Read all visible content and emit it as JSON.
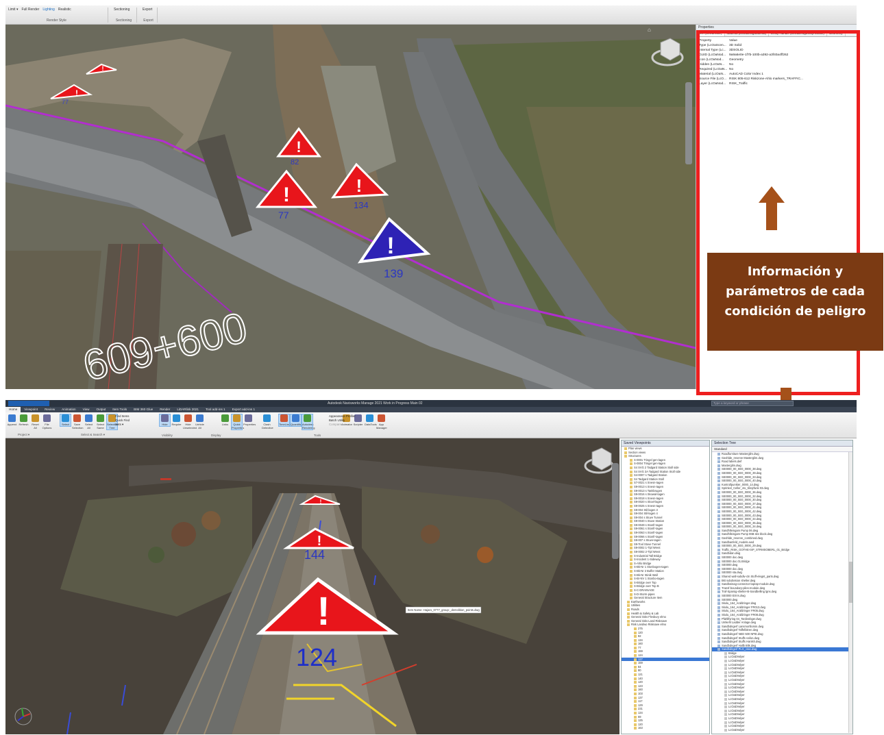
{
  "top_ribbon": {
    "groups": [
      {
        "title": "Render Style",
        "items": [
          "Limit ▾",
          "Full Render",
          "Lighting",
          "Realistic"
        ]
      },
      {
        "title": "Sectioning",
        "items": [
          "Sectioning"
        ]
      },
      {
        "title": "Export",
        "items": [
          "Export"
        ]
      }
    ]
  },
  "properties_panel": {
    "title": "Properties",
    "tabs": [
      "Item (LcOaNode)",
      "Material (LcOaDrwgMaterial)",
      "Entity Handle (LcOaDrwgEntityHandle)",
      "Geometry"
    ],
    "header": {
      "key": "Property",
      "value": "Value"
    },
    "rows": [
      {
        "k": "Type (LcOaScen...",
        "v": "3D Solid"
      },
      {
        "k": "Internal Type (Lc...",
        "v": "3DSOLID"
      },
      {
        "k": "GUID (LcOaNod...",
        "v": "9a9a6e0e-1f7b-100b-a392-a3f40a4ff262"
      },
      {
        "k": "Icon (LcOaNod...",
        "v": "Geometry"
      },
      {
        "k": "Hidden (LcOaN...",
        "v": "No"
      },
      {
        "k": "Required (LcOaN...",
        "v": "No"
      },
      {
        "k": "Material (LcOaN...",
        "v": "AutoCAD Color Index 1"
      },
      {
        "k": "Source File (LcO...",
        "v": "RISK 805-612 Riskzone-Ahlo markers_TRAFFIC..."
      },
      {
        "k": "Layer (LcOaNod...",
        "v": "RISK_Traffic"
      }
    ]
  },
  "callout": {
    "line1": "Información y",
    "line2": "parámetros de cada",
    "line3": "condición de peligro"
  },
  "viewport_top": {
    "chainage": "609+600",
    "hazards": [
      "77",
      "82",
      "77",
      "134",
      "139"
    ]
  },
  "app": {
    "title": "Autodesk Navisworks Manage 2021   Work in Progress Main 02",
    "search_placeholder": "Type a keyword or phrase",
    "tabs": [
      "Home",
      "Viewpoint",
      "Review",
      "Animation",
      "View",
      "Output",
      "Item Tools",
      "BIM 360 Glue",
      "Render",
      "LiDARlink 2021",
      "Tool add-ins 1",
      "Export add-ins 1"
    ],
    "tools": [
      {
        "label": "Append",
        "sel": false
      },
      {
        "label": "Refresh",
        "sel": false
      },
      {
        "label": "Reset All",
        "sel": false
      },
      {
        "label": "File Options",
        "sel": false
      },
      {
        "label": "Select",
        "sel": true
      },
      {
        "label": "Save Selection",
        "sel": false
      },
      {
        "label": "Select All",
        "sel": false
      },
      {
        "label": "Select Same",
        "sel": false
      },
      {
        "label": "Selection Tree",
        "sel": true
      },
      {
        "label": "Hide",
        "sel": true
      },
      {
        "label": "Require",
        "sel": false
      },
      {
        "label": "Hide Unselected",
        "sel": false
      },
      {
        "label": "Unhide All",
        "sel": false
      },
      {
        "label": "Links",
        "sel": false
      },
      {
        "label": "Quick Properties",
        "sel": true
      },
      {
        "label": "Properties",
        "sel": false
      },
      {
        "label": "Clash Detective",
        "sel": false
      },
      {
        "label": "TimeLiner",
        "sel": true
      },
      {
        "label": "Quantification",
        "sel": true
      },
      {
        "label": "Autodesk Rendering",
        "sel": true
      },
      {
        "label": "Animator",
        "sel": false
      },
      {
        "label": "Scripter",
        "sel": false
      },
      {
        "label": "DataTools",
        "sel": false
      },
      {
        "label": "App Manager",
        "sel": false
      }
    ],
    "find_items": [
      "Find Items",
      "Quick Find",
      "Sets ▾"
    ],
    "tools_menu": [
      "Appearance Profiler",
      "Batch Utility",
      "Compare"
    ],
    "groups": [
      "Project ▾",
      "Select & Search ▾",
      "Visibility",
      "Display",
      "Tools"
    ]
  },
  "viewport_bottom": {
    "hazards": [
      "",
      "144",
      "124"
    ],
    "tooltip": "Item Name: Hajaro_0777_group:_demolition_points.dwg"
  },
  "selection_tree": {
    "title": "Saved Viewpoints",
    "rows": [
      "Plan views",
      "Section views",
      "Structures",
      "S-0001 Tringel gen-lagen",
      "S-0004 Tringel gen-lagen",
      "S4 SVG 2 Tadgard Station Stoll side",
      "S4 SVG 3A Tadgard Station Stoll side",
      "S4-0007 s Tadgard Station",
      "S4 Tadgard Station Stoll",
      "S7-0021 s Snesn-tagen",
      "S9-0013 s Snesn-tagen",
      "S9-0013 s Tankbrugen",
      "S9-0016 s Skowal-tagen",
      "S9-0018 s Snesn-tagen",
      "S9-0020 s Skovl-lagen",
      "S9-0025 s Snesn-tagen",
      "S9-004 Stil-lagen 3",
      "S9-004 Stil-lagen 4",
      "S9-004 s Stuve Tunnel",
      "S9-0040 s Stuve Station",
      "S9-0049 s Stonfr-tagen",
      "S9-0061 s Stonfr-tagen",
      "S9-0063 s Stonfr-tagen",
      "S9-0066 s Stonfr-tagen",
      "S9-007 s Stuve-tagen",
      "S9-Tool Stove Tunnel",
      "S9-0002 1-Tipl Wrest",
      "S9-0002 2-Tipl Wrest",
      "S-Industrial Tall Bridge",
      "S-Incident 1-Sideway",
      "S-Ahlo Bridge",
      "S-Bk-Nr 1 Stonbogen-tagen",
      "S-Bk-Nr 2 Buffer Station",
      "S-Bk-Nr Stinik Wall",
      "S-Br-NV 1 Stonbo-tagen",
      "S-Bridge over Top",
      "S-Bridge over Top B",
      "S-C-DRAINAGE",
      "S-D-Storm-pipes",
      "General Structure Item",
      "Earthworks",
      "Utilities",
      "Roads",
      "Health & Safety & Lab",
      "General risks Flesbury elmo",
      "General risks Land Risksave",
      "Risk Landwo Risksave elmo",
      "275",
      "120",
      "82",
      "134",
      "160",
      "77",
      "159",
      "124",
      "127",
      "159",
      "84",
      "80",
      "121",
      "140",
      "120",
      "123",
      "160",
      "103",
      "137",
      "117",
      "129",
      "231",
      "134",
      "69",
      "125",
      "120",
      "163"
    ],
    "selected_index": 55
  },
  "selection_list": {
    "title": "Selection Tree",
    "head": "Standard",
    "rows": [
      "Roadfurniture Masterglim.dwg",
      "Gashlde_reserve Masterglim.dwg",
      "Road labels.dwf",
      "Masterglim.dwg",
      "SE0000_00_SE0_0000_38.dwg",
      "SE0000_00_SE0_0000_39.dwg",
      "SE0000_00_SE0_0000_33.dwg",
      "SE0000_00_SE0_0000_40.dwg",
      "Kontrollpunkter_0000_14.dwg",
      "Sprinkel_Celler_vtx_Sitejrfunk 03.dwg",
      "SE0000_00_SE0_0000_36.dwg",
      "SE0000_00_SE0_0000_32.dwg",
      "SE0000_00_SE0_0000_30.dwg",
      "SE0000_00_SE0_0000_37.dwg",
      "SE0000_00_SE0_0000_41.dwg",
      "SE0000_00_SE0_0000_42.dwg",
      "SE0000_00_SE0_0000_43.dwg",
      "SE0000_00_SE0_0000_44.dwg",
      "SE0000_00_SE0_0000_35.dwg",
      "SE0000_00_SE0_0000_34.dwg",
      "Sandhlleingam Pump 06.dwg",
      "Sandhlleingam Pump 06B site block.dwg",
      "Gashlde_reserve_combined.dwg",
      "Sandbanfeld_models.ewd",
      "SE0000_00_SE0_0000_29.dwg",
      "Traffic_RISK_GOTHE-ISP_STRMSOBERL_01_Bridge",
      "Sandbdan.dwg",
      "SE0000 doc.dwg",
      "SE0000 doc.01.Bridge",
      "SE0000.dwg",
      "SE0000 doc.dwg",
      "SE0000 sta.dwg",
      "Shared wall-subdiv-ctn Stoff-elegnt_parts.dwg",
      "Bkt subdivision shelter.dwg",
      "Sandbeinag-connector-laprap-module.dwg",
      "Transf-boundary-piles-module.dwg",
      "Traf-Sparsig-shelter-B-Sandbelling lgns.dwg",
      "SE0000 ESVs.dwg",
      "SE0000.dwg",
      "Skolu_164_Arafdringer.dwg",
      "Skolu_164_Arafdringer FR013.dwg",
      "Skolu_164_Arafdringer FR05.dwg",
      "Skolu_164_Arafdringer FR08.dwg",
      "Pfahllfyring 04_Tanlinnbger.dwg",
      "Umkehl Ladder Anlage.dwg",
      "Sandbdngerf Lansmortliorsin.dwg",
      "Sandbdngerf Taffelbitren.dwg",
      "Sandbdngerf NED 500 NPIE.dwg",
      "Sandbdngerf Stuffs nafon.dwg",
      "Sandbdngerf Stuffs Hanlsh.dwg",
      "Sandbdngerf Hallb Blik.dwg",
      "Sandbdngerf PLG_ctan.dwg",
      "Bridge",
      "LcOaDrwlyer",
      "LcOaDrwlyer",
      "LcOaDrwlyer",
      "LcOaDrwlyer",
      "LcOaDrwlyer",
      "LcOaDrwlyer",
      "LcOaDrwlyer",
      "LcOaDrwlyer",
      "LcOaDrwlyer",
      "LcOaDrwlyer",
      "LcOaDrwlyer",
      "LcOaDrwlyer",
      "LcOaDrwlyer",
      "LcOaDrwlyer",
      "LcOaDrwlyer",
      "LcOaDrwlyer",
      "LcOaDrwlyer",
      "LcOaDrwlyer",
      "LcOaDrwlyer",
      "LcOaDrwlyer"
    ],
    "selected_index": 51
  },
  "colors": {
    "hazard_red": "#e8151b",
    "hazard_blue": "#2e22b5",
    "frame_red": "#ee1f1f",
    "callout_brown": "#7b3a13",
    "arrow_brown": "#a5511a"
  }
}
